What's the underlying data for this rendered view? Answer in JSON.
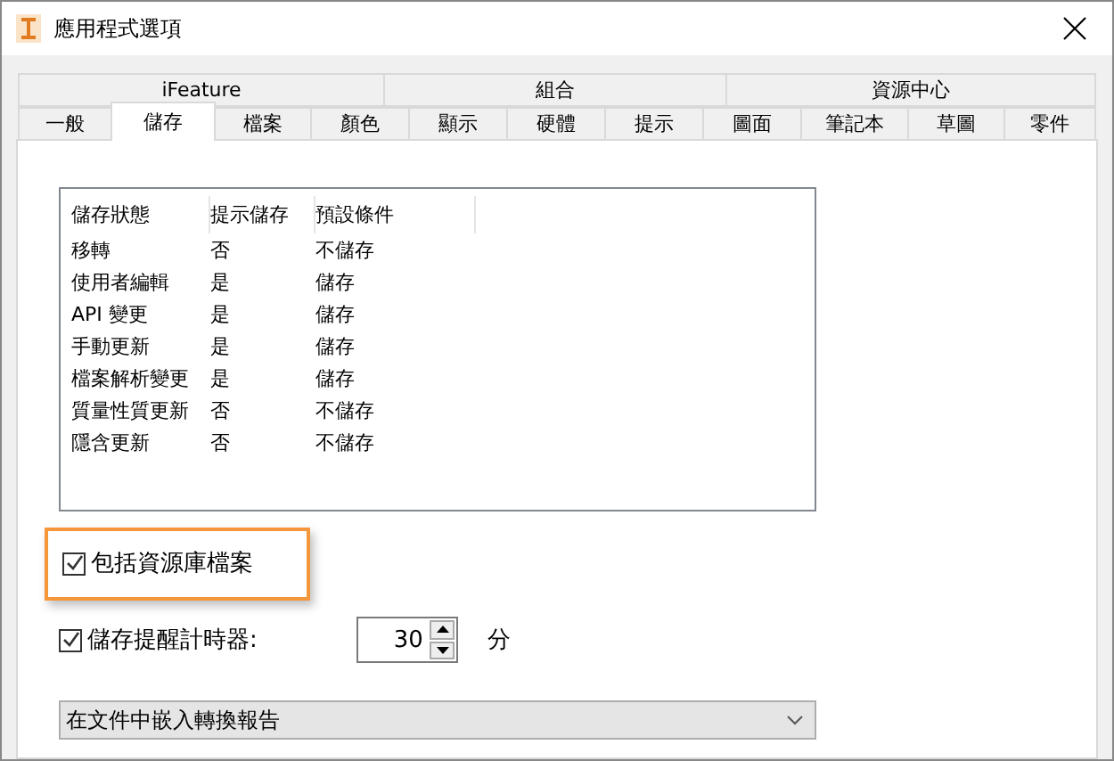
{
  "window": {
    "title": "應用程式選項"
  },
  "tab_rows": [
    [
      {
        "label": "iFeature",
        "selected": false
      },
      {
        "label": "組合",
        "selected": false
      },
      {
        "label": "資源中心",
        "selected": false
      }
    ],
    [
      {
        "label": "一般",
        "selected": false
      },
      {
        "label": "儲存",
        "selected": true
      },
      {
        "label": "檔案",
        "selected": false
      },
      {
        "label": "顏色",
        "selected": false
      },
      {
        "label": "顯示",
        "selected": false
      },
      {
        "label": "硬體",
        "selected": false
      },
      {
        "label": "提示",
        "selected": false
      },
      {
        "label": "圖面",
        "selected": false
      },
      {
        "label": "筆記本",
        "selected": false
      },
      {
        "label": "草圖",
        "selected": false
      },
      {
        "label": "零件",
        "selected": false
      }
    ]
  ],
  "table": {
    "columns": [
      "儲存狀態",
      "提示儲存",
      "預設條件"
    ],
    "rows": [
      [
        "移轉",
        "否",
        "不儲存"
      ],
      [
        "使用者編輯",
        "是",
        "儲存"
      ],
      [
        "API 變更",
        "是",
        "儲存"
      ],
      [
        "手動更新",
        "是",
        "儲存"
      ],
      [
        "檔案解析變更",
        "是",
        "儲存"
      ],
      [
        "質量性質更新",
        "否",
        "不儲存"
      ],
      [
        "隱含更新",
        "否",
        "不儲存"
      ]
    ]
  },
  "include_library": {
    "label": "包括資源庫檔案",
    "checked": true,
    "highlighted": true
  },
  "reminder": {
    "label": "儲存提醒計時器:",
    "checked": true,
    "value": "30",
    "unit": "分"
  },
  "dropdown": {
    "value": "在文件中嵌入轉換報告"
  }
}
